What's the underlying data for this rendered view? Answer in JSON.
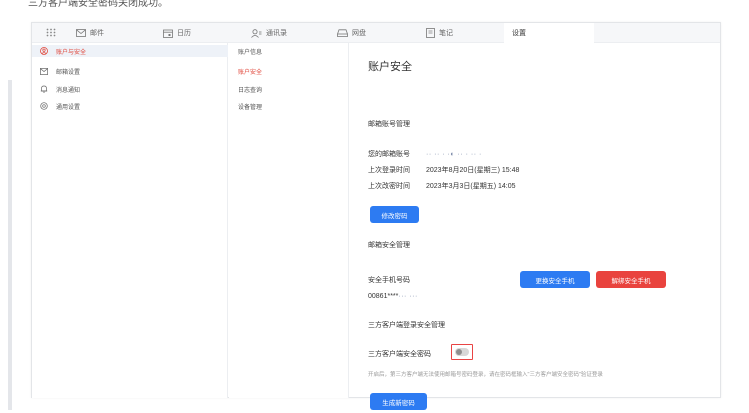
{
  "caption": "三方客户端安全密码关闭成功。",
  "colors": {
    "accent_red": "#e0463a",
    "button_blue": "#2d7bf2",
    "button_red": "#e9433e"
  },
  "topnav": {
    "tabs": [
      {
        "label": "邮件",
        "icon": "mail-icon"
      },
      {
        "label": "日历",
        "icon": "calendar-icon"
      },
      {
        "label": "通讯录",
        "icon": "contacts-icon"
      },
      {
        "label": "网盘",
        "icon": "cloud-drive-icon"
      },
      {
        "label": "笔记",
        "icon": "notes-icon"
      },
      {
        "label": "设置",
        "icon": ""
      }
    ]
  },
  "sidebar": {
    "items": [
      {
        "label": "账户与安全",
        "icon": "user-shield-icon"
      },
      {
        "label": "邮箱设置",
        "icon": "mail-settings-icon"
      },
      {
        "label": "消息通知",
        "icon": "bell-icon"
      },
      {
        "label": "通用设置",
        "icon": "gear-icon"
      }
    ]
  },
  "subnav": {
    "items": [
      {
        "label": "账户信息"
      },
      {
        "label": "账户安全"
      },
      {
        "label": "日志查询"
      },
      {
        "label": "设备管理"
      }
    ]
  },
  "content": {
    "title": "账户安全",
    "mailbox_section": "邮箱账号管理",
    "account_label": "您的邮箱账号",
    "account_value": "·· ·· · ·◐ ·· · ·· ·",
    "last_login_label": "上次登录时间",
    "last_login_value": "2023年8月20日(星期三) 15:48",
    "last_pwd_label": "上次改密时间",
    "last_pwd_value": "2023年3月3日(星期五) 14:05",
    "change_pwd_button": "修改密码",
    "mail_security_section": "邮箱安全管理",
    "phone_label": "安全手机号码",
    "phone_value": "00861****",
    "phone_masked": "··· ···",
    "change_phone_button": "更换安全手机",
    "unbind_phone_button": "解绑安全手机",
    "client_section": "三方客户端登录安全管理",
    "client_pwd_label": "三方客户端安全密码",
    "client_pwd_note": "开启后，第三方客户端无法使用邮箱号密码登录，请在密码框输入\"三方客户端安全密码\"验证登录",
    "generate_button": "生成新密码"
  }
}
